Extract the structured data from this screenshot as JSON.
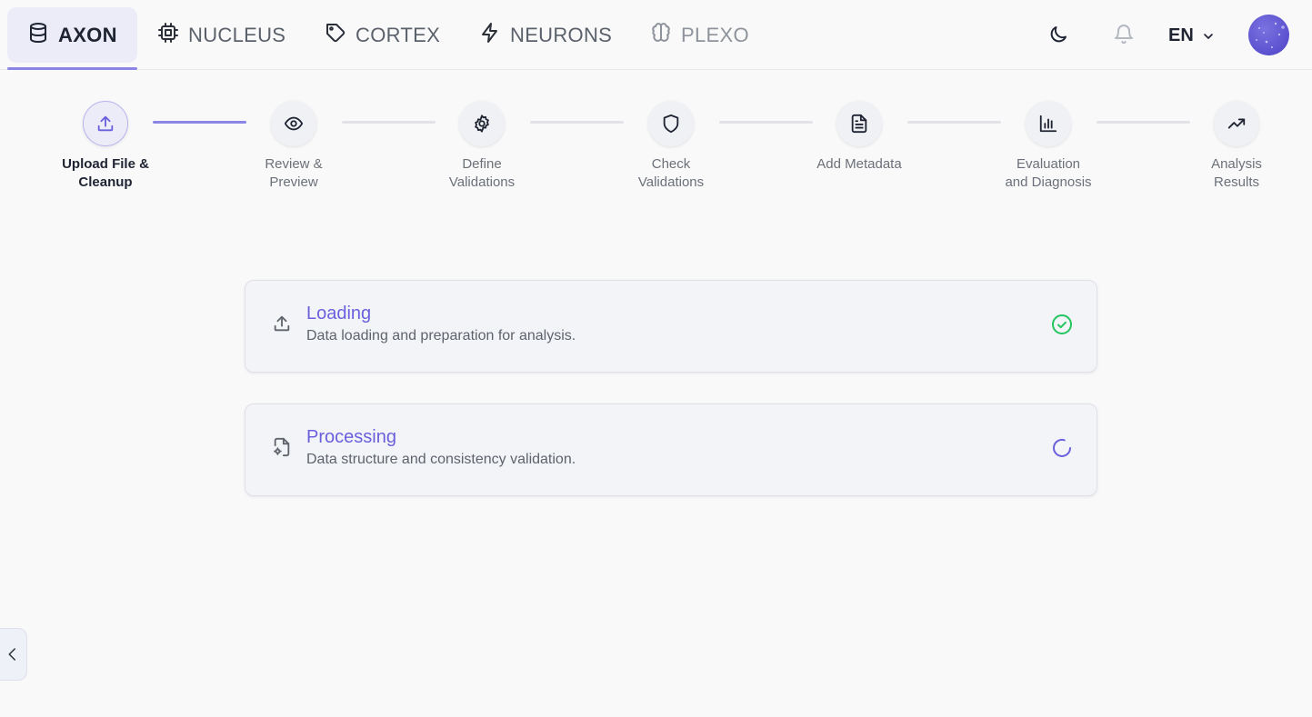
{
  "nav": {
    "tabs": [
      {
        "label": "AXON",
        "icon": "database-icon",
        "state": "active"
      },
      {
        "label": "NUCLEUS",
        "icon": "cpu-icon",
        "state": "normal"
      },
      {
        "label": "CORTEX",
        "icon": "tag-icon",
        "state": "normal"
      },
      {
        "label": "NEURONS",
        "icon": "lightning-icon",
        "state": "normal"
      },
      {
        "label": "PLEXO",
        "icon": "brain-icon",
        "state": "disabled"
      }
    ],
    "language": "EN",
    "tools": [
      "moon-icon",
      "bell-icon"
    ]
  },
  "stepper": {
    "current_index": 0,
    "steps": [
      {
        "label": "Upload File &\nCleanup",
        "icon": "upload-icon"
      },
      {
        "label": "Review &\nPreview",
        "icon": "eye-icon"
      },
      {
        "label": "Define\nValidations",
        "icon": "gear-icon"
      },
      {
        "label": "Check\nValidations",
        "icon": "shield-icon"
      },
      {
        "label": "Add Metadata",
        "icon": "document-icon"
      },
      {
        "label": "Evaluation\nand Diagnosis",
        "icon": "bar-chart-icon"
      },
      {
        "label": "Analysis\nResults",
        "icon": "trending-up-icon"
      }
    ]
  },
  "tasks": [
    {
      "title": "Loading",
      "description": "Data loading and preparation for analysis.",
      "icon": "upload-icon",
      "status": "completed"
    },
    {
      "title": "Processing",
      "description": "Data structure and consistency validation.",
      "icon": "file-gear-icon",
      "status": "in-progress"
    }
  ],
  "colors": {
    "accent": "#6a5fdc",
    "accent_line": "#8b85e6",
    "success": "#22c55e"
  }
}
